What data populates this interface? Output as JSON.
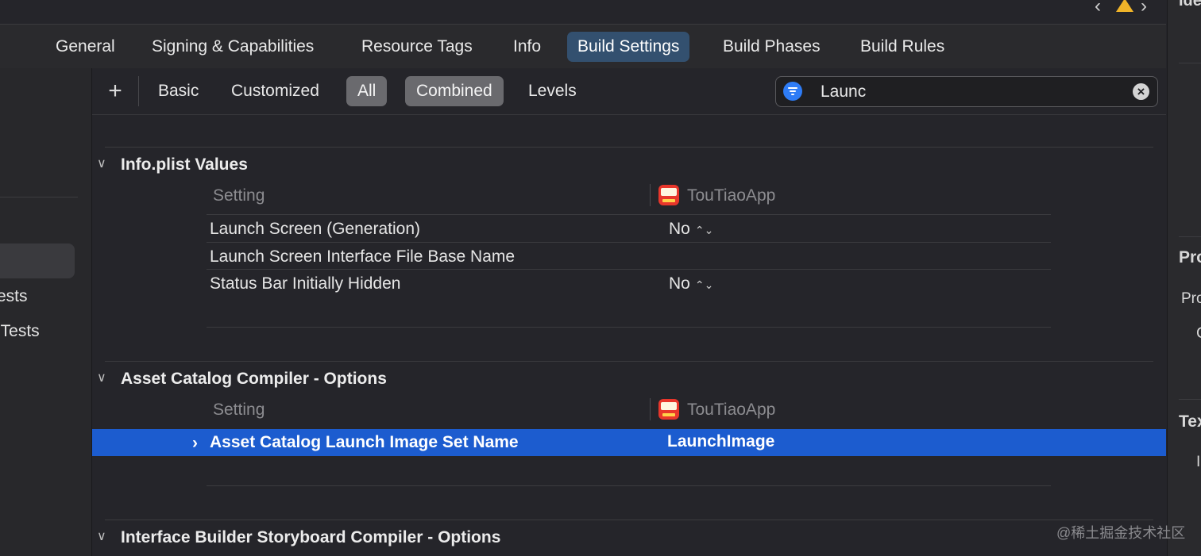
{
  "tabs": [
    "General",
    "Signing & Capabilities",
    "Resource Tags",
    "Info",
    "Build Settings",
    "Build Phases",
    "Build Rules"
  ],
  "active_tab": "Build Settings",
  "sidebar": {
    "items": [
      "ests",
      "lTests"
    ]
  },
  "filter": {
    "basic": "Basic",
    "customized": "Customized",
    "all": "All",
    "combined": "Combined",
    "levels": "Levels",
    "search_value": "Launc"
  },
  "sections": {
    "info_plist": {
      "title": "Info.plist Values",
      "setting_header": "Setting",
      "target_name": "TouTiaoApp",
      "rows": [
        {
          "name": "Launch Screen (Generation)",
          "value": "No"
        },
        {
          "name": "Launch Screen Interface File Base Name",
          "value": ""
        },
        {
          "name": "Status Bar Initially Hidden",
          "value": "No"
        }
      ]
    },
    "asset_catalog": {
      "title": "Asset Catalog Compiler - Options",
      "setting_header": "Setting",
      "target_name": "TouTiaoApp",
      "rows": [
        {
          "name": "Asset Catalog Launch Image Set Name",
          "value": "LaunchImage"
        }
      ]
    },
    "interface_builder": {
      "title": "Interface Builder Storyboard Compiler - Options"
    }
  },
  "inspector": {
    "labels": [
      "Ide",
      "Pro",
      "Pro",
      "C",
      "Tex",
      "I"
    ]
  },
  "watermark": "@稀土掘金技术社区"
}
